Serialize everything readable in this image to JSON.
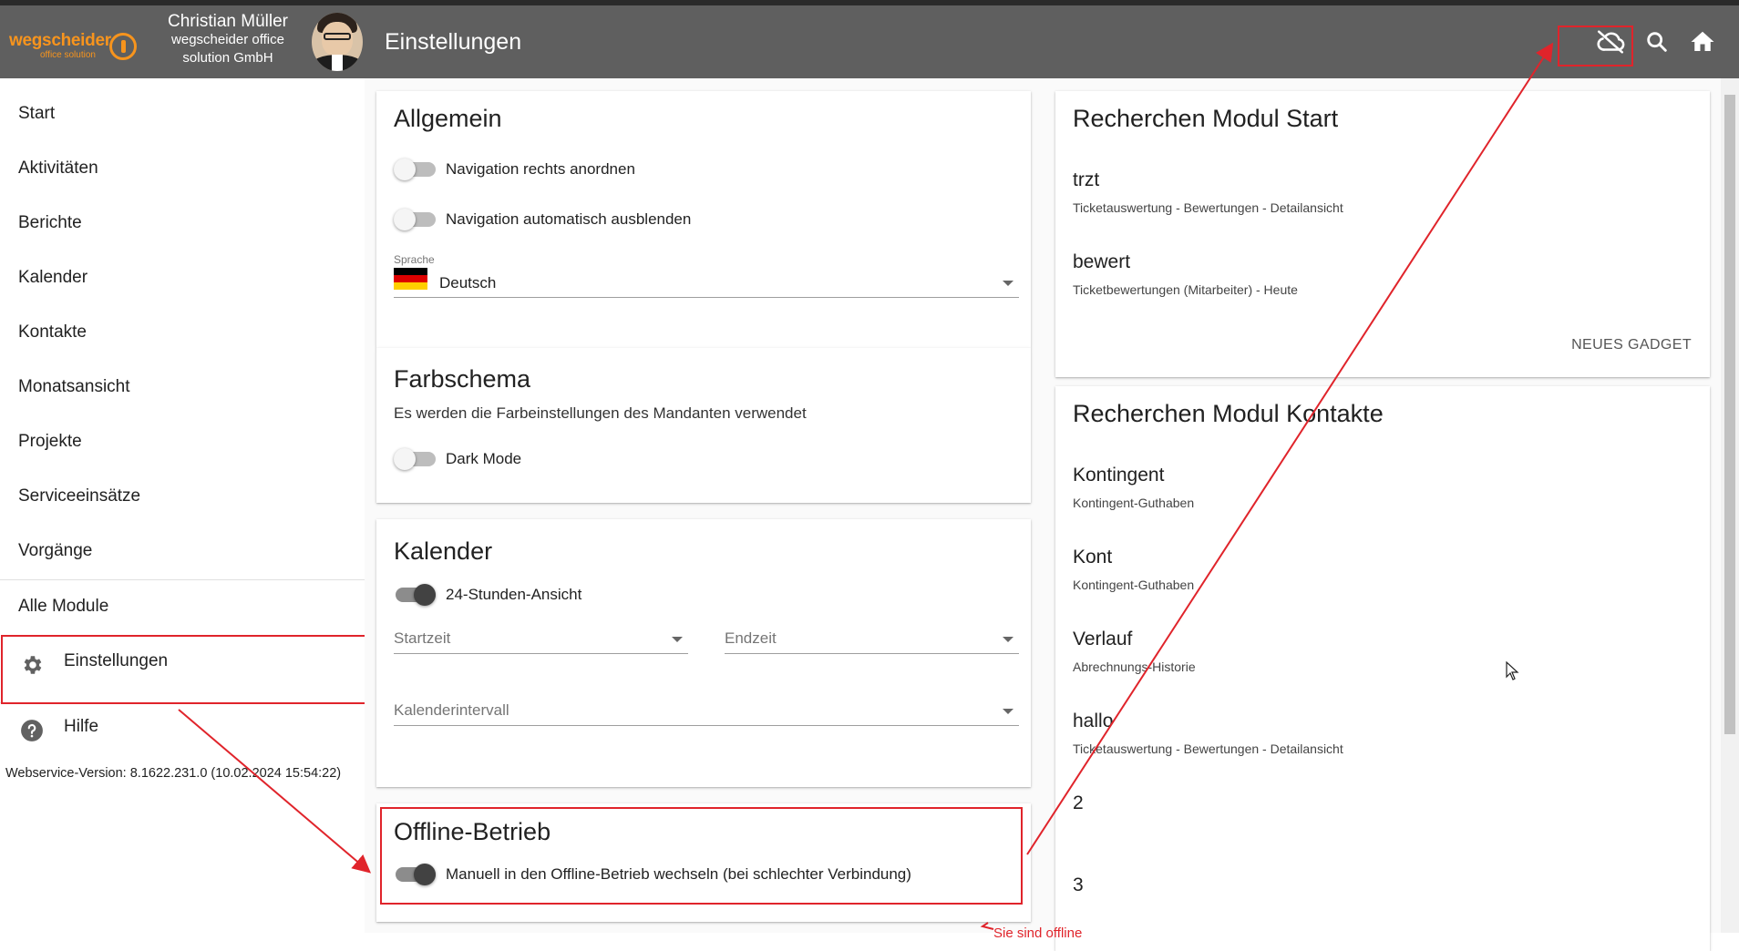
{
  "header": {
    "logo_text": "wegscheider",
    "logo_sub": "office solution",
    "user_name": "Christian Müller",
    "user_company": "wegscheider office solution GmbH",
    "page_title": "Einstellungen",
    "icons": [
      "cloud-off-icon",
      "search-icon",
      "home-icon"
    ]
  },
  "sidebar": {
    "items": [
      {
        "label": "Start"
      },
      {
        "label": "Aktivitäten"
      },
      {
        "label": "Berichte"
      },
      {
        "label": "Kalender"
      },
      {
        "label": "Kontakte"
      },
      {
        "label": "Monatsansicht"
      },
      {
        "label": "Projekte"
      },
      {
        "label": "Serviceeinsätze"
      },
      {
        "label": "Vorgänge"
      },
      {
        "label": "Alle Module"
      }
    ],
    "settings_label": "Einstellungen",
    "help_label": "Hilfe",
    "version": "Webservice-Version: 8.1622.231.0 (10.02.2024 15:54:22)"
  },
  "allgemein": {
    "title": "Allgemein",
    "toggle1_label": "Navigation rechts anordnen",
    "toggle1_on": false,
    "toggle2_label": "Navigation automatisch ausblenden",
    "toggle2_on": false,
    "language_label": "Sprache",
    "language_value": "Deutsch"
  },
  "farbschema": {
    "title": "Farbschema",
    "description": "Es werden die Farbeinstellungen des Mandanten verwendet",
    "darkmode_label": "Dark Mode",
    "darkmode_on": false
  },
  "kalender": {
    "title": "Kalender",
    "toggle_label": "24-Stunden-Ansicht",
    "toggle_on": true,
    "start_placeholder": "Startzeit",
    "end_placeholder": "Endzeit",
    "interval_placeholder": "Kalenderintervall"
  },
  "offline": {
    "title": "Offline-Betrieb",
    "toggle_label": "Manuell in den Offline-Betrieb wechseln (bei schlechter Verbindung)",
    "toggle_on": true,
    "status_message": "Sie sind offline"
  },
  "recherche_start": {
    "title": "Recherchen Modul Start",
    "items": [
      {
        "title": "trzt",
        "subtitle": "Ticketauswertung - Bewertungen - Detailansicht"
      },
      {
        "title": "bewert",
        "subtitle": "Ticketbewertungen (Mitarbeiter) - Heute"
      }
    ],
    "new_gadget_label": "NEUES GADGET"
  },
  "recherche_kontakte": {
    "title": "Recherchen Modul Kontakte",
    "items": [
      {
        "title": "Kontingent",
        "subtitle": "Kontingent-Guthaben"
      },
      {
        "title": "Kont",
        "subtitle": "Kontingent-Guthaben"
      },
      {
        "title": "Verlauf",
        "subtitle": "Abrechnungs-Historie"
      },
      {
        "title": "hallo",
        "subtitle": "Ticketauswertung - Bewertungen - Detailansicht"
      },
      {
        "title": "2",
        "subtitle": ""
      },
      {
        "title": "3",
        "subtitle": ""
      }
    ]
  },
  "colors": {
    "header_bg": "#5f5f5f",
    "brand_orange": "#f7941d",
    "annotation_red": "#e0242b"
  }
}
